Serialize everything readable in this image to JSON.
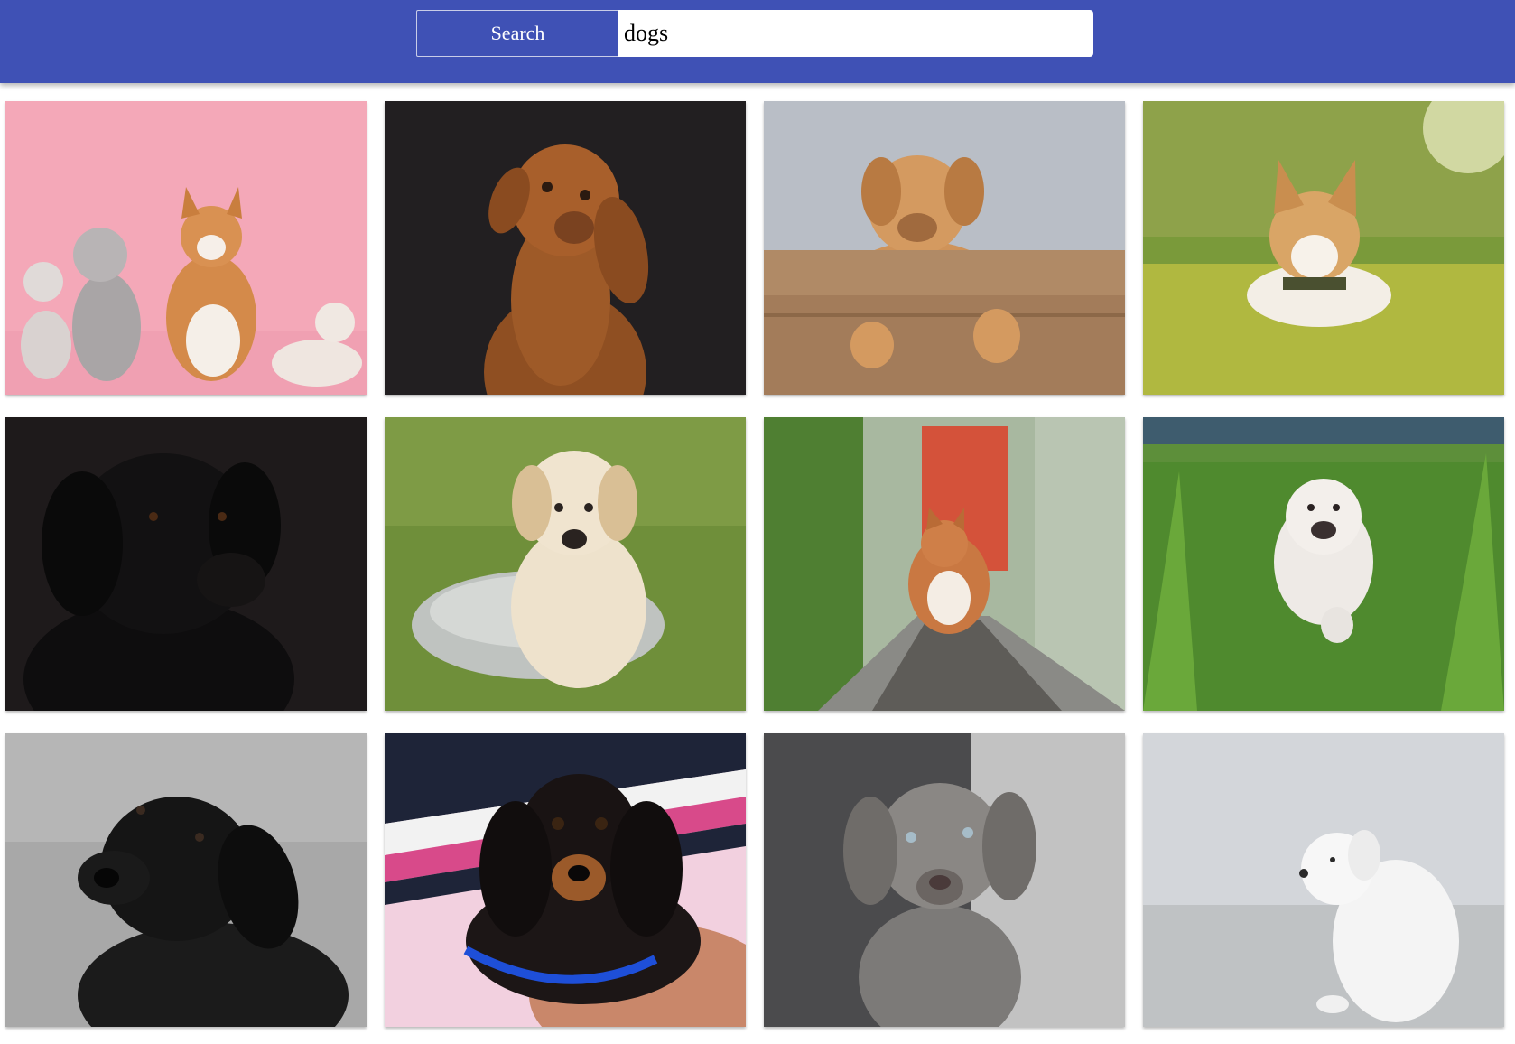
{
  "search": {
    "button_label": "Search",
    "query": "dogs"
  },
  "colors": {
    "app_bar": "#3f51b5",
    "background": "#ffffff"
  },
  "results": [
    {
      "row": 1,
      "col": 1,
      "subject": "corgi-poodle-and-cats-pink-backdrop"
    },
    {
      "row": 1,
      "col": 2,
      "subject": "vizsla-dark-backdrop"
    },
    {
      "row": 1,
      "col": 3,
      "subject": "mastiff-puppy-on-crate"
    },
    {
      "row": 1,
      "col": 4,
      "subject": "corgi-lying-in-grass"
    },
    {
      "row": 2,
      "col": 1,
      "subject": "black-labrador-dark-backdrop"
    },
    {
      "row": 2,
      "col": 2,
      "subject": "golden-puppy-in-bowl"
    },
    {
      "row": 2,
      "col": 3,
      "subject": "corgi-on-railway"
    },
    {
      "row": 2,
      "col": 4,
      "subject": "samoyed-in-tall-grass"
    },
    {
      "row": 3,
      "col": 1,
      "subject": "black-labrador-monochrome"
    },
    {
      "row": 3,
      "col": 2,
      "subject": "dachshund-puppy-in-arms"
    },
    {
      "row": 3,
      "col": 3,
      "subject": "weimaraner-puppy"
    },
    {
      "row": 3,
      "col": 4,
      "subject": "white-puppy-sitting"
    }
  ]
}
